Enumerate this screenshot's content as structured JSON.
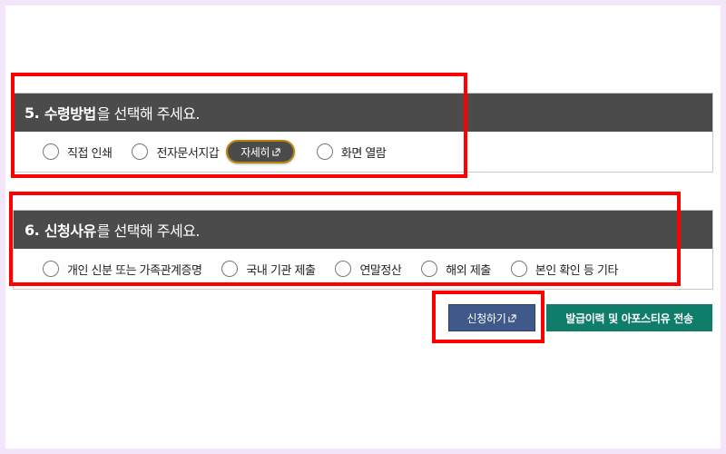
{
  "section5": {
    "number": "5.",
    "title_bold": "수령방법",
    "title_rest": "을 선택해 주세요.",
    "options": [
      "직접 인쇄",
      "전자문서지갑",
      "화면 열람"
    ],
    "detail_button": "자세히"
  },
  "section6": {
    "number": "6.",
    "title_bold": "신청사유",
    "title_rest": "를 선택해 주세요.",
    "options": [
      "개인 신분 또는 가족관계증명",
      "국내 기관 제출",
      "연말정산",
      "해외 제출",
      "본인 확인 등 기타"
    ]
  },
  "actions": {
    "apply_button": "신청하기",
    "send_button": "발급이력 및 아포스티유 전송"
  },
  "colors": {
    "header_bg": "#4b4b4b",
    "highlight": "#ff0000",
    "apply_bg": "#3f5a8a",
    "send_bg": "#0f7d6a"
  },
  "icons": {
    "external_link": "external-link-icon"
  }
}
